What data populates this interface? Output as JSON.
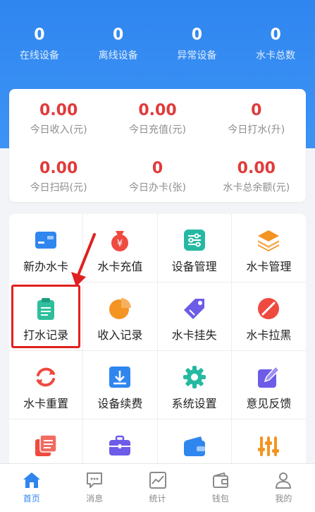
{
  "top_stats": [
    {
      "value": "0",
      "label": "在线设备"
    },
    {
      "value": "0",
      "label": "离线设备"
    },
    {
      "value": "0",
      "label": "异常设备"
    },
    {
      "value": "0",
      "label": "水卡总数"
    }
  ],
  "card_stats": [
    {
      "value": "0.00",
      "label": "今日收入(元)"
    },
    {
      "value": "0.00",
      "label": "今日充值(元)"
    },
    {
      "value": "0",
      "label": "今日打水(升)"
    },
    {
      "value": "0.00",
      "label": "今日扫码(元)"
    },
    {
      "value": "0",
      "label": "今日办卡(张)"
    },
    {
      "value": "0.00",
      "label": "水卡总余额(元)"
    }
  ],
  "menu": [
    {
      "label": "新办水卡",
      "icon": "new-card-icon"
    },
    {
      "label": "水卡充值",
      "icon": "money-bag-icon"
    },
    {
      "label": "设备管理",
      "icon": "sliders-icon"
    },
    {
      "label": "水卡管理",
      "icon": "layers-icon"
    },
    {
      "label": "打水记录",
      "icon": "clipboard-icon"
    },
    {
      "label": "收入记录",
      "icon": "pie-chart-icon"
    },
    {
      "label": "水卡挂失",
      "icon": "tag-icon"
    },
    {
      "label": "水卡拉黑",
      "icon": "block-icon"
    },
    {
      "label": "水卡重置",
      "icon": "refresh-icon"
    },
    {
      "label": "设备续费",
      "icon": "download-icon"
    },
    {
      "label": "系统设置",
      "icon": "gear-icon"
    },
    {
      "label": "意见反馈",
      "icon": "edit-icon"
    },
    {
      "label": "",
      "icon": "list-icon"
    },
    {
      "label": "",
      "icon": "briefcase-icon"
    },
    {
      "label": "",
      "icon": "wallet-icon"
    },
    {
      "label": "",
      "icon": "equalizer-icon"
    }
  ],
  "tabs": [
    {
      "label": "首页",
      "icon": "home-icon",
      "active": true
    },
    {
      "label": "消息",
      "icon": "message-icon",
      "active": false
    },
    {
      "label": "统计",
      "icon": "chart-icon",
      "active": false
    },
    {
      "label": "钱包",
      "icon": "wallet-icon",
      "active": false
    },
    {
      "label": "我的",
      "icon": "user-icon",
      "active": false
    }
  ],
  "colors": {
    "header": "#2f86ef",
    "stat_value": "#e03b3b",
    "highlight": "#e02020",
    "active_tab": "#2f86ef"
  }
}
